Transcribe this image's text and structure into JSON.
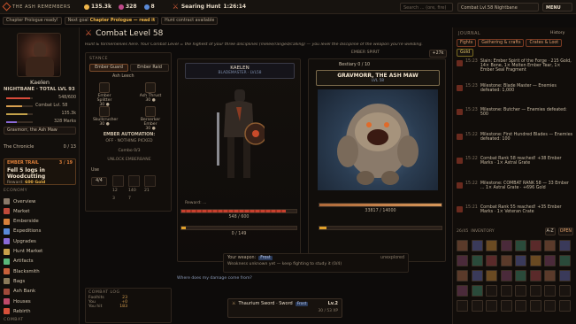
{
  "app": {
    "title": "THE ASH REMEMBERS"
  },
  "top": {
    "gold": "135.3k",
    "gems": "328",
    "essence": "8",
    "timer_label": "Searing Hunt",
    "timer": "1:26:14",
    "search_placeholder": "Search ... (ore, fire)",
    "combat_tag": "Combat Lvl.58 Nightbane",
    "menu": "MENU"
  },
  "colors": {
    "accent": "#e0603a",
    "gold": "#f0b64a",
    "hp": "#d84a3a",
    "energy": "#e08a2a"
  },
  "sub": {
    "ready": "Chapter Prologue ready!",
    "next_label": "Next goal",
    "next_goal": "Chapter Prologue — read it",
    "hunt": "Hunt contract available"
  },
  "player": {
    "name": "Kaelen",
    "title": "NIGHTBANE · TOTAL LVL 93",
    "stats": [
      {
        "label": "",
        "value": "548/600",
        "pct": 0.91,
        "color": "#d84a3a"
      },
      {
        "label": "Combat Lvl. 58",
        "value": "",
        "pct": 0.6,
        "color": "#d8a050"
      },
      {
        "label": "",
        "value": "135.3k",
        "pct": 0.8,
        "color": "#c4a24a"
      },
      {
        "label": "",
        "value": "328 Marks",
        "pct": 0.4,
        "color": "#8a6ad8"
      }
    ],
    "zone": "Gravmorr, the Ash Maw",
    "chronicle": "The Chronicle",
    "chronicle_count": "0 / 13"
  },
  "trail": {
    "label": "EMBER TRAIL",
    "count": "3 / 19",
    "quest": "Fell 5 logs in Woodcutting",
    "reward_label": "Reward:",
    "reward": "600 Gold"
  },
  "nav": {
    "economy": "ECONOMY",
    "items": [
      "Overview",
      "Market",
      "Emberside",
      "Expeditions",
      "Upgrades",
      "Hunt Market",
      "Artifacts",
      "Blacksmith",
      "Bags",
      "Ash Bank",
      "Houses",
      "Rebirth"
    ],
    "combat": "COMBAT"
  },
  "combat": {
    "title": "Combat Level 58",
    "desc": "Hunt & formemenies here. Your Combat Level = the highest of your three disciplines (melee/ranged/calling) — you level the discipline of the weapon you're wielding.",
    "stance_label": "STANCE",
    "stance1": "Ember Guard",
    "stance2": "Ember Raid",
    "stance3": "Ash Leech",
    "skills": [
      {
        "name": "Ember Splitter",
        "lvl": "30 ●"
      },
      {
        "name": "Ash Thrust",
        "lvl": "30 ●"
      },
      {
        "name": "Skullcrusher",
        "lvl": "30 ●"
      },
      {
        "name": "Berserker Ember",
        "lvl": "30 ●"
      }
    ],
    "automation": "EMBER AUTOMATION:",
    "automation_state": "OFF · NOTHING PICKED",
    "combo": "Combo 0/3",
    "unlock": "UNLOCK EMBERBANE",
    "use": "Use",
    "slots": [
      "4/4",
      "12",
      "140",
      "21",
      "3",
      "7"
    ]
  },
  "player_card": {
    "name": "KAELEN",
    "sub": "BLADEMASTER · LVL58",
    "hp": "548 / 600",
    "xp": "0 / 149",
    "reward": "Reward: ..."
  },
  "enemy": {
    "spirit_label": "EMBER SPIRIT",
    "bestiary": "Bestiary 0 / 10",
    "name": "GRAVMORR, THE ASH MAW",
    "lvl": "LVL 58",
    "hp": "33817 / 14000",
    "loot_chip": "+27k"
  },
  "info": {
    "weapon_label": "Your weapon:",
    "weapon_tag": "Frost",
    "status": "unexplored",
    "weak": "Weakness unknown yet — keep fighting to study it (0/4)",
    "hint": "Where does my damage come from?"
  },
  "log": {
    "label": "COMBAT LOG",
    "rows": [
      {
        "name": "Foolhits",
        "val": "23"
      },
      {
        "name": "You",
        "val": "+0"
      },
      {
        "name": "You hit",
        "val": "183"
      }
    ]
  },
  "weapon": {
    "name": "Thaurium Sword · Sword",
    "tag": "Frost",
    "lvl": "Lv.2",
    "xp": "30 / 53 XP"
  },
  "journal": {
    "label": "JOURNAL",
    "history": "History",
    "filters": [
      "Fights",
      "Gathering & crafts",
      "Crates & Loot",
      "Gold"
    ],
    "entries": [
      {
        "time": "15:23",
        "text": "Slain: Ember Spirit of the Forge · 215 Gold, 14× Bone, 1× Molten Ember Tear, 1× Ember Seal Fragment"
      },
      {
        "time": "15:23",
        "text": "Milestone: Blade Master — Enemies defeated: 1,000"
      },
      {
        "time": "15:23",
        "text": "Milestone: Butcher — Enemies defeated: 500"
      },
      {
        "time": "15:22",
        "text": "Milestone: First Hundred Blades — Enemies defeated: 100"
      },
      {
        "time": "15:22",
        "text": "Combat Rank 58 reached! +38 Ember Marks · 1× Astral Grate"
      },
      {
        "time": "15:22",
        "text": "Milestone: COMBAT RANK 58 — 33 Ember ... 1× Astral Grate · +696 Gold"
      },
      {
        "time": "15:21",
        "text": "Combat Rank 55 reached! +35 Ember Marks · 1× Veteran Crate"
      }
    ]
  },
  "inventory": {
    "label": "INVENTORY",
    "count": "26/45",
    "sort": "A-Z",
    "open": "OPEN"
  }
}
